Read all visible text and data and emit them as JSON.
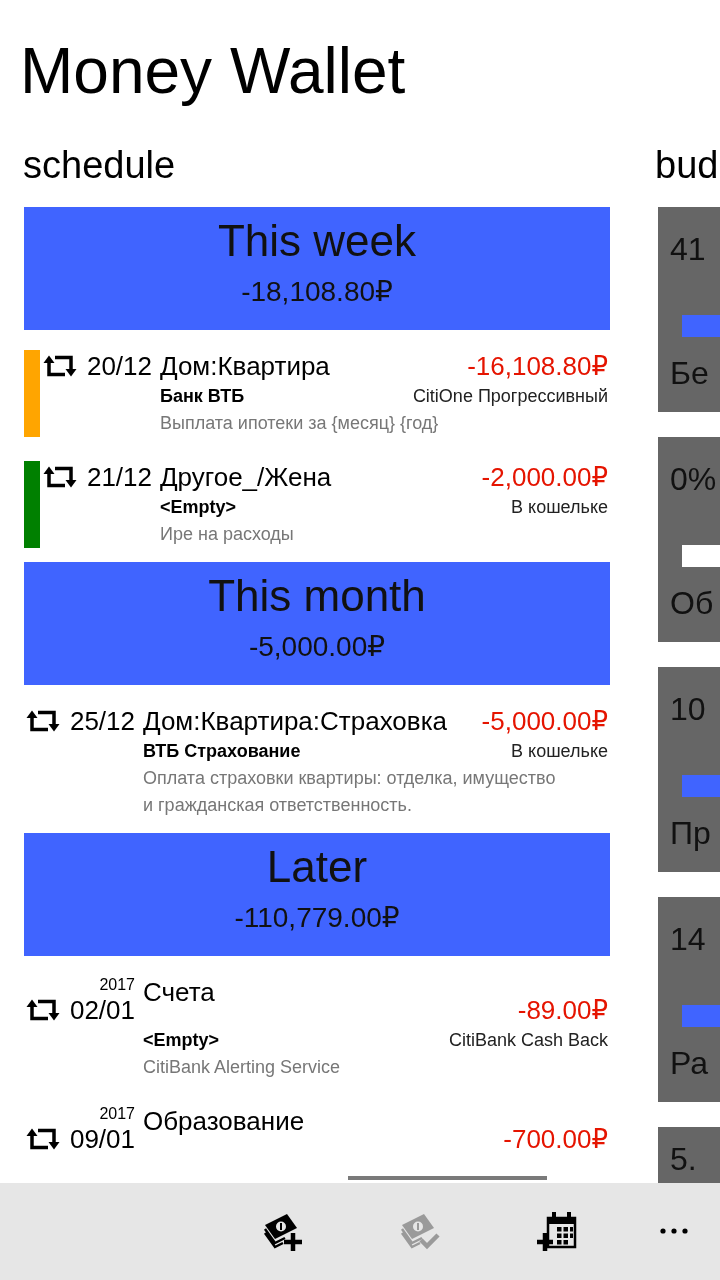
{
  "app": {
    "title": "Money Wallet"
  },
  "schedule": {
    "heading": "schedule",
    "groups": [
      {
        "title": "This week",
        "total": "-18,108.80₽",
        "items": [
          {
            "color": "#ffa500",
            "date": "20/12",
            "category": "Дом:Квартира",
            "amount": "-16,108.80₽",
            "payee": "Банк ВТБ",
            "account": "CitiOne Прогрессивный",
            "note": "Выплата ипотеки за {месяц} {год}"
          },
          {
            "color": "#008000",
            "date": "21/12",
            "category": "Другое_/Жена",
            "amount": "-2,000.00₽",
            "payee": "<Empty>",
            "account": "В кошельке",
            "note": "Ире на расходы"
          }
        ]
      },
      {
        "title": "This month",
        "total": "-5,000.00₽",
        "items": [
          {
            "date": "25/12",
            "category": "Дом:Квартира:Страховка",
            "amount": "-5,000.00₽",
            "payee": "ВТБ Страхование",
            "account": "В кошельке",
            "note": "Оплата страховки квартиры: отделка, имущество и гражданская ответственность."
          }
        ]
      },
      {
        "title": "Later",
        "total": "-110,779.00₽",
        "items": [
          {
            "year": "2017",
            "date": "02/01",
            "category": "Счета",
            "amount": "-89.00₽",
            "payee": "<Empty>",
            "account": "CitiBank Cash Back",
            "note": "CitiBank Alerting Service"
          },
          {
            "year": "2017",
            "date": "09/01",
            "category": "Образование",
            "amount": "-700.00₽"
          }
        ]
      }
    ]
  },
  "budgets": {
    "heading": "bud",
    "items": [
      {
        "figure": "41",
        "level": 1,
        "title": "Бе"
      },
      {
        "figure": "0%",
        "title": "Об"
      },
      {
        "figure": "10",
        "level": 1,
        "title": "Пр"
      },
      {
        "figure": "14",
        "level": 1,
        "title": "Ра"
      },
      {
        "figure": "5."
      }
    ]
  },
  "app_bar": {
    "buttons": [
      {
        "kind": "add_money",
        "disabled": false
      },
      {
        "kind": "pay_money",
        "disabled": true
      },
      {
        "kind": "add_schedule",
        "disabled": false
      }
    ]
  }
}
